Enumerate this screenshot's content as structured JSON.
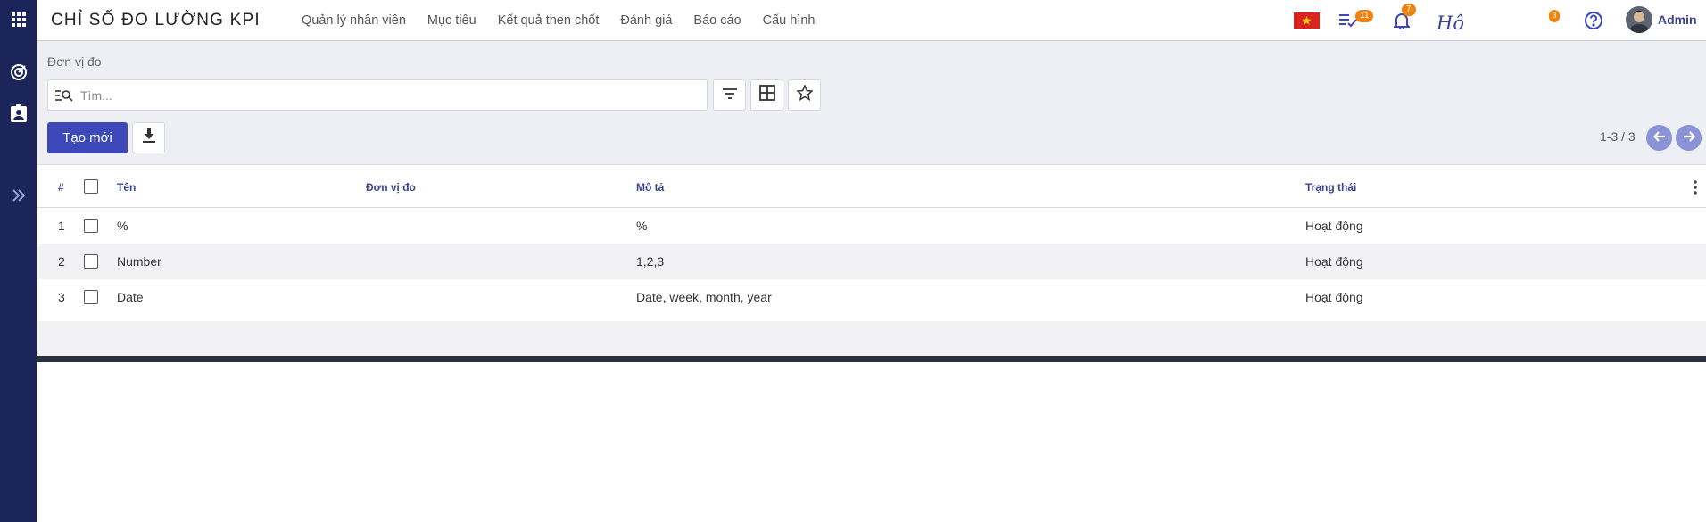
{
  "app": {
    "title": "CHỈ SỐ ĐO LƯỜNG KPI"
  },
  "menu": [
    "Quản lý nhân viên",
    "Mục tiêu",
    "Kết quả then chốt",
    "Đánh giá",
    "Báo cáo",
    "Cấu hình"
  ],
  "topbar": {
    "activity_count": "11",
    "notification_count": "7",
    "cursive_text": "Hô",
    "chat_count": "3",
    "user_name": "Admin"
  },
  "breadcrumb": "Đơn vị đo",
  "search": {
    "placeholder": "Tìm..."
  },
  "actions": {
    "create_label": "Tạo mới"
  },
  "pager": {
    "text": "1-3 / 3"
  },
  "table": {
    "headers": {
      "num": "#",
      "name": "Tên",
      "unit": "Đơn vị đo",
      "desc": "Mô tả",
      "status": "Trạng thái"
    },
    "rows": [
      {
        "num": "1",
        "name": "%",
        "unit": "",
        "desc": "%",
        "status": "Hoạt động"
      },
      {
        "num": "2",
        "name": "Number",
        "unit": "",
        "desc": "1,2,3",
        "status": "Hoạt động"
      },
      {
        "num": "3",
        "name": "Date",
        "unit": "",
        "desc": "Date, week, month, year",
        "status": "Hoạt động"
      }
    ]
  },
  "colors": {
    "rail": "#1c2559",
    "primary": "#3d48b8",
    "badge": "#f0830f",
    "header_text": "#3a438f"
  }
}
